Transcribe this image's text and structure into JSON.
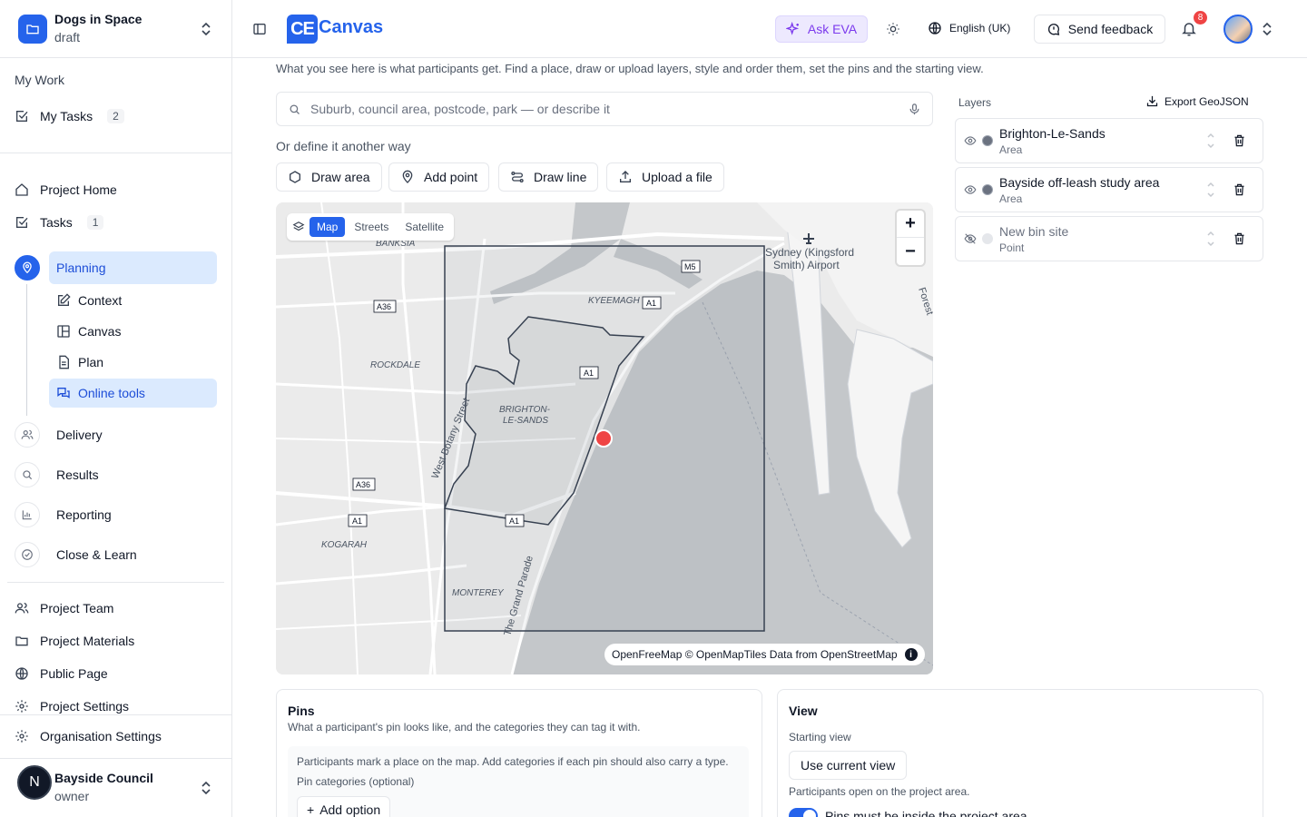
{
  "project": {
    "name": "Dogs in Space",
    "status": "draft"
  },
  "sidebar": {
    "my_work_label": "My Work",
    "my_tasks": {
      "label": "My Tasks",
      "count": "2"
    },
    "project_home": "Project Home",
    "tasks": {
      "label": "Tasks",
      "count": "1"
    },
    "stages": [
      {
        "label": "Planning",
        "icon": "map-pin-icon",
        "active": true
      },
      {
        "label": "Delivery",
        "icon": "users-icon"
      },
      {
        "label": "Results",
        "icon": "search-icon"
      },
      {
        "label": "Reporting",
        "icon": "bar-chart-icon"
      },
      {
        "label": "Close & Learn",
        "icon": "check-circle-icon"
      }
    ],
    "planning_items": [
      {
        "label": "Context",
        "icon": "edit-square-icon"
      },
      {
        "label": "Canvas",
        "icon": "layout-icon"
      },
      {
        "label": "Plan",
        "icon": "document-icon"
      },
      {
        "label": "Online tools",
        "icon": "chat-icon",
        "active": true
      }
    ],
    "footer_items": [
      {
        "label": "Project Team",
        "icon": "users-icon"
      },
      {
        "label": "Project Materials",
        "icon": "folder-icon"
      },
      {
        "label": "Public Page",
        "icon": "globe-icon"
      },
      {
        "label": "Project Settings",
        "icon": "gear-icon"
      }
    ],
    "org_settings": "Organisation Settings",
    "org": {
      "initial": "N",
      "name": "Bayside Council",
      "role": "owner"
    }
  },
  "topbar": {
    "brand_mark": "CE",
    "brand_text": "Canvas",
    "ask_eva": "Ask EVA",
    "language": "English (UK)",
    "feedback": "Send feedback",
    "notifications": "8"
  },
  "main": {
    "intro": "What you see here is what participants get. Find a place, draw or upload layers, style and order them, set the pins and the starting view.",
    "search_placeholder": "Suburb, council area, postcode, park — or describe it",
    "or_define": "Or define it another way",
    "tools": [
      "Draw area",
      "Add point",
      "Draw line",
      "Upload a file"
    ]
  },
  "map": {
    "tabs": [
      "Map",
      "Streets",
      "Satellite"
    ],
    "active_tab": "Map",
    "zoom_in": "+",
    "zoom_out": "−",
    "attribution": "OpenFreeMap © OpenMapTiles Data from OpenStreetMap",
    "attribution_info": "i",
    "labels": {
      "banksia": "BANKSIA",
      "kyeemagh": "KYEEMAGH",
      "rockdale": "ROCKDALE",
      "brighton_1": "BRIGHTON-",
      "brighton_2": "LE-SANDS",
      "kogarah": "KOGARAH",
      "monterey": "MONTEREY",
      "airport_1": "Sydney (Kingsford",
      "airport_2": "Smith) Airport",
      "west_botany": "West Botany Street",
      "grand_parade": "The Grand Parade",
      "forest": "Forest",
      "m5": "M5",
      "a1": "A1",
      "a36": "A36",
      "a36_2": "A36",
      "a1_2": "A1",
      "a1_3": "A1",
      "a1_4": "A1"
    },
    "colors": {
      "water": "#c4c7ca",
      "land": "#ebebeb",
      "pin": "#ef4444",
      "outline": "#374151"
    }
  },
  "layers": {
    "title": "Layers",
    "export": "Export GeoJSON",
    "items": [
      {
        "name": "Brighton-Le-Sands",
        "type": "Area",
        "visible": true
      },
      {
        "name": "Bayside off-leash study area",
        "type": "Area",
        "visible": true
      },
      {
        "name": "New bin site",
        "type": "Point",
        "visible": false
      }
    ]
  },
  "pins": {
    "title": "Pins",
    "subtitle": "What a participant's pin looks like, and the categories they can tag it with.",
    "note": "Participants mark a place on the map. Add categories if each pin should also carry a type.",
    "categories_label": "Pin categories (optional)",
    "add_option": "Add option"
  },
  "view": {
    "title": "View",
    "starting_view_label": "Starting view",
    "use_current": "Use current view",
    "note": "Participants open on the project area.",
    "toggle_label": "Pins must be inside the project area",
    "toggle_on": true
  }
}
